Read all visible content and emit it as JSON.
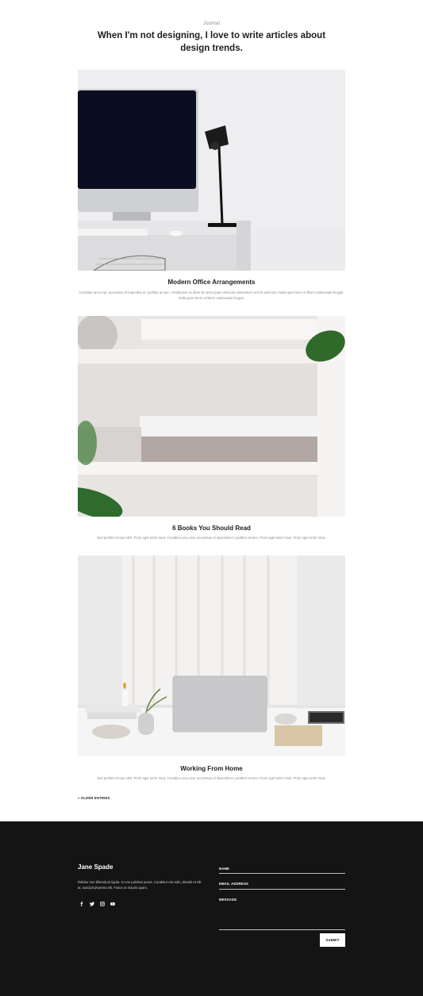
{
  "header": {
    "eyebrow": "Journal",
    "headline": "When I'm not designing, I love to write articles about design trends."
  },
  "posts": [
    {
      "title": "Modern Office Arrangements",
      "excerpt": "Curabitur arcu erat, accumsan id imperdiet et, porttitor at sem. Vestibulum ac diam sit amet quam vehicula elementum sed sit amet dui. Nulla quis lorem ut libero malesuada feugiat. Nulla quis lorem ut libero malesuada feugiat."
    },
    {
      "title": "6 Books You Should Read",
      "excerpt": "Sed porttitor lectus nibh. Proin eget tortor risus. Curabitur arcu erat, accumsan id imperdiet et, porttitor at sem. Proin eget tortor risus. Proin eget tortor risus."
    },
    {
      "title": "Working From Home",
      "excerpt": "Sed porttitor lectus nibh. Proin eget tortor risus. Curabitur arcu erat, accumsan id imperdiet et, porttitor at sem. Proin eget tortor risus. Proin eget tortor risus."
    }
  ],
  "pagination": {
    "older_label": "« OLDER ENTRIES"
  },
  "footer": {
    "brand": "Jane Spade",
    "about": "Rabitur non bibendum ligula. In non pulvinar purus. Curabitur nisi odio, blandit et elit at, suscipit pharetra elit. Fusce ut mauris quam.",
    "socials": [
      "facebook-icon",
      "twitter-icon",
      "instagram-icon",
      "youtube-icon"
    ],
    "form": {
      "name_label": "NAME",
      "email_label": "EMAIL ADDRESS",
      "message_label": "MESSAGE",
      "submit_label": "SUBMIT"
    }
  },
  "colors": {
    "footer_bg": "#141414",
    "text_dark": "#1e1e1e",
    "text_muted": "#8a8a8a"
  }
}
